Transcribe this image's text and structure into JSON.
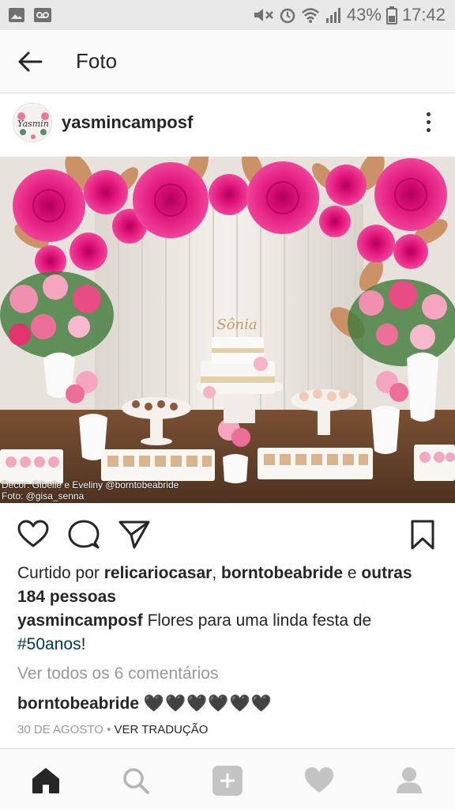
{
  "status_bar": {
    "battery": "43%",
    "time": "17:42",
    "icons": [
      "image-icon",
      "voicemail-icon",
      "mute-icon",
      "alarm-icon",
      "wifi-icon",
      "signal-icon",
      "battery-icon"
    ]
  },
  "app_bar": {
    "title": "Foto",
    "back_icon": "arrow-left-icon"
  },
  "post": {
    "username": "yasmincamposf",
    "avatar_text": "Yasmin",
    "menu_icon": "more-vertical-icon",
    "photo_credit_1": "Decor: Gibelle e Eveliny @borntobeabride",
    "photo_credit_2": "Foto: @gisa_senna",
    "cake_topper": "Sônia",
    "likes_prefix": "Curtido por",
    "liker1": "relicariocasar",
    "liker_sep": ",",
    "liker2": "borntobeabride",
    "likes_and": "e",
    "likes_others": "outras 184 pessoas",
    "caption_user": "yasmincamposf",
    "caption_text": "Flores para uma linda festa de",
    "caption_hashtag": "#50anos",
    "caption_end": "!",
    "view_comments": "Ver todos os 6 comentários",
    "comment_user": "borntobeabride",
    "comment_text": "🖤🖤🖤🖤🖤🖤",
    "date": "30 DE AGOSTO",
    "meta_sep": " • ",
    "translate": "VER TRADUÇÃO"
  },
  "actions": [
    "heart-icon",
    "comment-icon",
    "share-icon",
    "bookmark-icon"
  ],
  "bottom_nav": [
    "home-icon",
    "search-icon",
    "add-icon",
    "activity-heart-icon",
    "profile-icon"
  ],
  "colors": {
    "hashtag": "#003569",
    "muted": "#999999",
    "text": "#262626",
    "pink": "#e0147a"
  }
}
